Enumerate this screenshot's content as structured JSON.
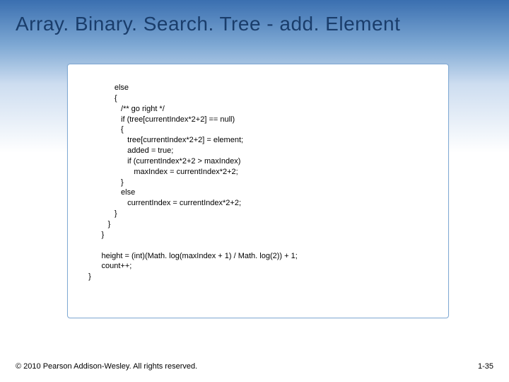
{
  "slide": {
    "title": "Array. Binary. Search. Tree - add. Element",
    "code": "               else\n               {\n                  /** go right */\n                  if (tree[currentIndex*2+2] == null)\n                  {\n                     tree[currentIndex*2+2] = element;\n                     added = true;\n                     if (currentIndex*2+2 > maxIndex)\n                        maxIndex = currentIndex*2+2;\n                  }\n                  else\n                     currentIndex = currentIndex*2+2;\n               }\n            }\n         }\n\n         height = (int)(Math. log(maxIndex + 1) / Math. log(2)) + 1;\n         count++;\n   }",
    "copyright": "© 2010 Pearson Addison-Wesley. All rights reserved.",
    "pageNumber": "1-35"
  }
}
